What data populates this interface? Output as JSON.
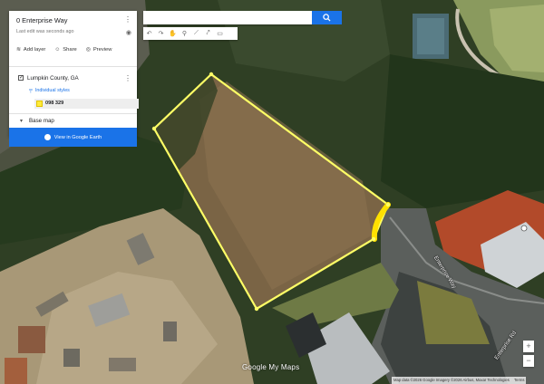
{
  "panel": {
    "title": "0 Enterprise Way",
    "subtitle": "Last edit was seconds ago",
    "actions": {
      "add_layer": "Add layer",
      "share": "Share",
      "preview": "Preview"
    },
    "layer": {
      "name": "Lumpkin County, GA",
      "style_link": "Individual styles",
      "feature": {
        "name": "098 329",
        "color": "#ffeb3b"
      }
    },
    "base_map": "Base map",
    "earth_button": "View in Google Earth"
  },
  "search": {
    "placeholder": ""
  },
  "toolbar": {
    "tools": [
      "undo-icon",
      "redo-icon",
      "hand-icon",
      "marker-icon",
      "draw-line-icon",
      "directions-icon",
      "ruler-icon"
    ]
  },
  "map": {
    "parcel_color": "#ffff66",
    "parcel_highlight_color": "#ffe100",
    "road_labels": [
      "Enterprise Way",
      "Enterprise Rd"
    ],
    "watermark": "Google My Maps",
    "attribution": "Map data ©2026 Google Imagery ©2026 Airbus, Maxar Technologies",
    "terms": "Terms",
    "zoom_in": "+",
    "zoom_out": "−"
  },
  "colors": {
    "accent": "#1a73e8"
  }
}
